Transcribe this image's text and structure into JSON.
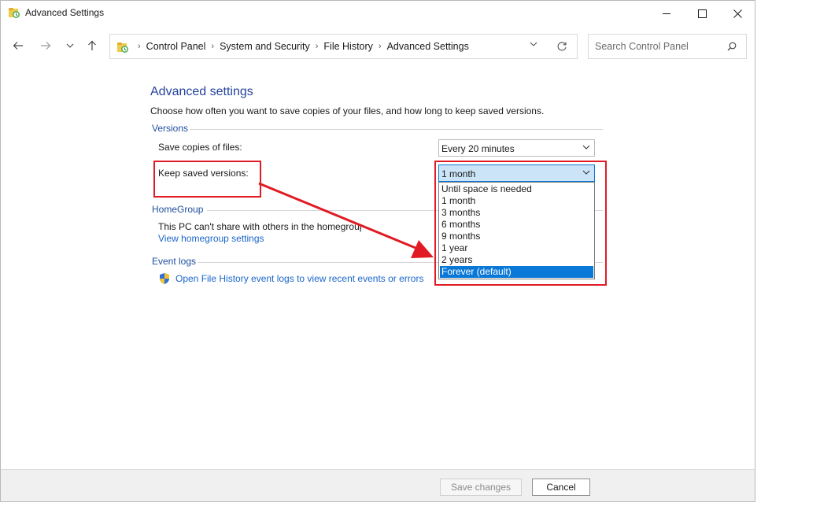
{
  "window": {
    "title": "Advanced Settings"
  },
  "breadcrumbs": [
    "Control Panel",
    "System and Security",
    "File History",
    "Advanced Settings"
  ],
  "search": {
    "placeholder": "Search Control Panel"
  },
  "page": {
    "title": "Advanced settings",
    "description": "Choose how often you want to save copies of your files, and how long to keep saved versions."
  },
  "versions": {
    "header": "Versions",
    "save_copies_label": "Save copies of files:",
    "save_copies_value": "Every 20 minutes",
    "keep_versions_label": "Keep saved versions:",
    "keep_versions_value": "1 month",
    "keep_versions_options": [
      "Until space is needed",
      "1 month",
      "3 months",
      "6 months",
      "9 months",
      "1 year",
      "2 years",
      "Forever (default)"
    ],
    "highlighted_option": "Forever (default)"
  },
  "homegroup": {
    "header": "HomeGroup",
    "text": "This PC can't share with others in the homegroup.",
    "link": "View homegroup settings"
  },
  "event_logs": {
    "header": "Event logs",
    "link": "Open File History event logs to view recent events or errors"
  },
  "footer": {
    "save_label": "Save changes",
    "cancel_label": "Cancel"
  },
  "colors": {
    "annotation_red": "#e01b24",
    "link_blue": "#1a66c9",
    "selection_blue": "#0a78d7"
  }
}
